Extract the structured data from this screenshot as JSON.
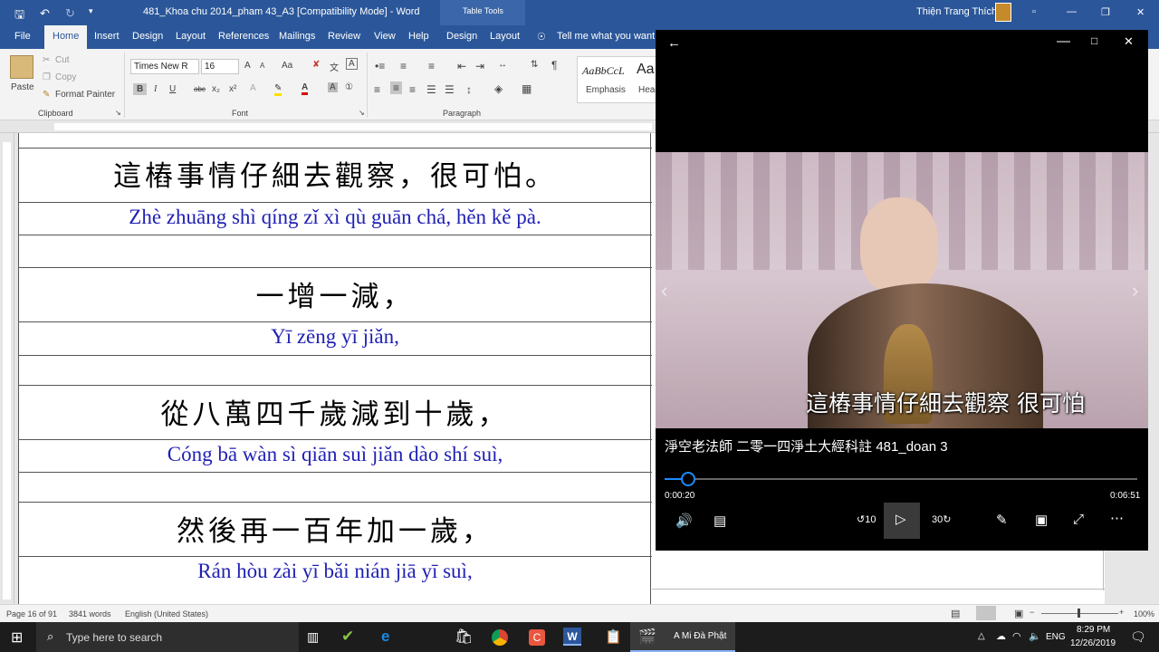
{
  "titlebar": {
    "save_icon": "save-icon",
    "undo_icon": "undo-icon",
    "redo_icon": "redo-icon",
    "doc_title": "481_Khoa chu 2014_pham 43_A3  [Compatibility Mode]  -  Word",
    "context_group": "Table Tools",
    "user": "Thiện Trang Thích"
  },
  "ribbon_tabs": [
    "File",
    "Home",
    "Insert",
    "Design",
    "Layout",
    "References",
    "Mailings",
    "Review",
    "View",
    "Help",
    "Design",
    "Layout"
  ],
  "tell_me": "Tell me what you want to",
  "clipboard": {
    "paste": "Paste",
    "cut": "Cut",
    "copy": "Copy",
    "format_painter": "Format Painter",
    "label": "Clipboard"
  },
  "font": {
    "name": "Times New R",
    "size": "16",
    "label": "Font",
    "grow": "A",
    "shrink": "A",
    "case": "Aa",
    "bold": "B",
    "italic": "I",
    "underline": "U",
    "strike": "abc",
    "sub": "x₂",
    "sup": "x²"
  },
  "paragraph": {
    "label": "Paragraph"
  },
  "styles": {
    "emphasis_preview": "AaBbCcL",
    "emphasis": "Emphasis",
    "heading_preview": "Aa",
    "heading": "Head"
  },
  "document": {
    "lines": [
      {
        "hanzi": "這樁事情仔細去觀察，很可怕。",
        "pinyin": "Zhè zhuāng shì qíng zǐ xì qù guān chá, hěn kě pà."
      },
      {
        "hanzi": "一增一減，",
        "pinyin": "Yī zēng yī jiǎn,"
      },
      {
        "hanzi": "從八萬四千歲減到十歲，",
        "pinyin": "Cóng bā wàn sì qiān suì jiǎn dào shí suì,"
      },
      {
        "hanzi": "然後再一百年加一歲，",
        "pinyin": "Rán hòu zài yī bǎi nián jiā yī suì,"
      }
    ]
  },
  "status": {
    "page": "Page 16 of 91",
    "words": "3841 words",
    "language": "English (United States)",
    "zoom": "100%"
  },
  "taskbar": {
    "search_placeholder": "Type here to search",
    "app_label": "A Mi Đà Phật",
    "lang": "ENG",
    "time": "8:29 PM",
    "date": "12/26/2019"
  },
  "player": {
    "caption": "這樁事情仔細去觀察  很可怕",
    "title": "淨空老法師 二零一四淨土大經科註 481_doan 3",
    "elapsed": "0:00:20",
    "total": "0:06:51",
    "progress_fraction": 0.05,
    "skip_back": "10",
    "skip_forward": "30"
  }
}
